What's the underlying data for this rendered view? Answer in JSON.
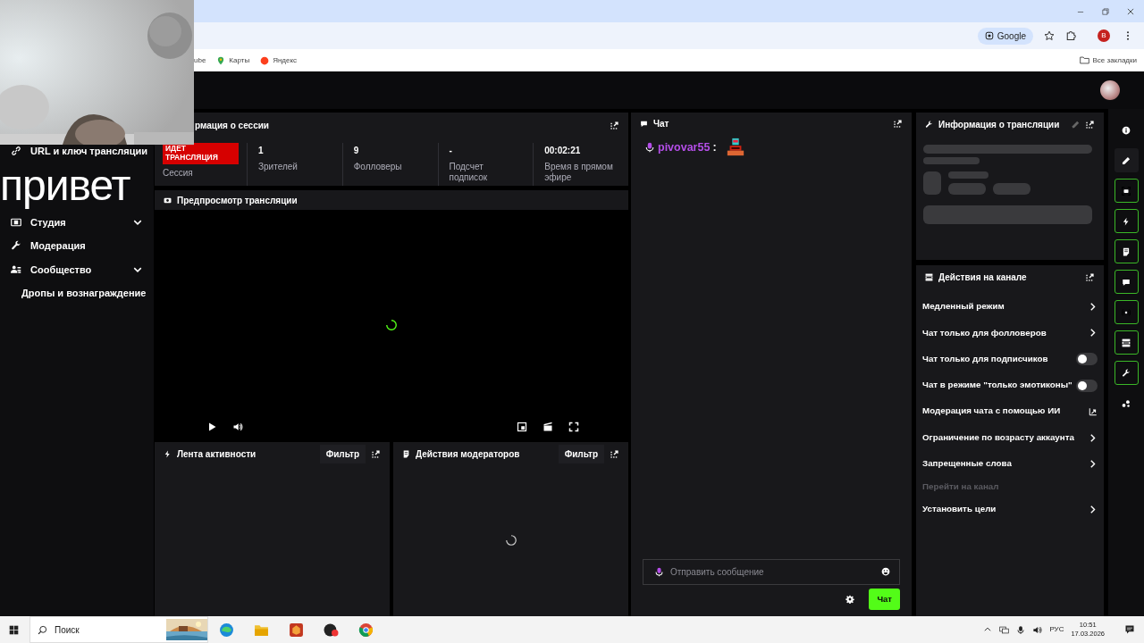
{
  "browser": {
    "bookmarks": [
      "ube",
      "Карты",
      "Яндекс"
    ],
    "lens_chip": "Google",
    "profile_initial": "В",
    "all_bookmarks": "Все закладки"
  },
  "overlay_caption": "привет",
  "sidebar": {
    "items": [
      {
        "label": "URL и ключ трансляции",
        "kind": "item",
        "expandable": false
      },
      {
        "label": "Студия",
        "kind": "item",
        "expandable": true
      },
      {
        "label": "Модерация",
        "kind": "item",
        "expandable": false
      },
      {
        "label": "Сообщество",
        "kind": "item",
        "expandable": true
      },
      {
        "label": "Дропы и вознаграждение",
        "kind": "sub",
        "expandable": false
      }
    ]
  },
  "session": {
    "title": "рмация о сессии",
    "status": "ИДЕТ ТРАНСЛЯЦИЯ",
    "status_caption": "Сессия",
    "stats": [
      {
        "value": "1",
        "label": "Зрителей"
      },
      {
        "value": "9",
        "label": "Фолловеры"
      },
      {
        "value": "-",
        "label": "Подсчет подписок"
      },
      {
        "value": "00:02:21",
        "label": "Время в прямом эфире"
      }
    ]
  },
  "preview": {
    "title": "Предпросмотр трансляции",
    "loading": true
  },
  "activity": {
    "title": "Лента активности",
    "filter": "Фильтр"
  },
  "mod_actions": {
    "title": "Действия модераторов",
    "filter": "Фильтр",
    "loading": true
  },
  "chat": {
    "title": "Чат",
    "messages": [
      {
        "user": "pivovar55",
        "separator": ":"
      }
    ],
    "placeholder": "Отправить сообщение",
    "send": "Чат"
  },
  "stream_info": {
    "title": "Информация о трансляции",
    "loading": true
  },
  "channel_actions": {
    "title": "Действия на канале",
    "items": [
      {
        "label": "Медленный режим",
        "kind": "arrow"
      },
      {
        "label": "Чат только для фолловеров",
        "kind": "arrow"
      },
      {
        "label": "Чат только для подписчиков",
        "kind": "toggle",
        "on": false
      },
      {
        "label": "Чат в режиме \"только эмотиконы\"",
        "kind": "toggle",
        "on": false
      },
      {
        "label": "Модерация чата с помощью ИИ",
        "kind": "external"
      },
      {
        "label": "Ограничение по возрасту аккаунта",
        "kind": "arrow"
      },
      {
        "label": "Запрещенные слова",
        "kind": "arrow"
      },
      {
        "label": "Перейти на канал",
        "kind": "muted"
      },
      {
        "label": "Установить цели",
        "kind": "arrow"
      }
    ]
  },
  "rail": [
    {
      "active": false
    },
    {
      "active": false
    },
    {
      "active": true
    },
    {
      "active": true
    },
    {
      "active": true
    },
    {
      "active": true
    },
    {
      "active": true
    },
    {
      "active": true
    },
    {
      "active": true
    },
    {
      "active": false
    }
  ],
  "taskbar": {
    "search": "Поиск",
    "language": "РУС",
    "time": "10:51",
    "date": "17.03.2026"
  }
}
